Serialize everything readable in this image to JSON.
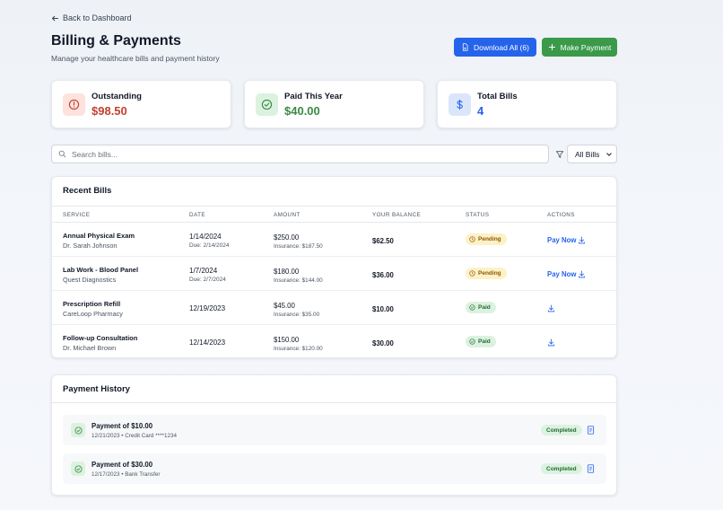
{
  "nav": {
    "back_label": "Back to Dashboard"
  },
  "header": {
    "title": "Billing & Payments",
    "subtitle": "Manage your healthcare bills and payment history",
    "download_label": "Download All (6)",
    "make_payment_label": "Make Payment"
  },
  "stats": [
    {
      "label": "Outstanding",
      "value": "$98.50",
      "icon": "alert-circle-icon",
      "color": "#c2412d",
      "bg": "#fde2de"
    },
    {
      "label": "Paid This Year",
      "value": "$40.00",
      "icon": "check-circle-icon",
      "color": "#3a8a44",
      "bg": "#dcf2e0"
    },
    {
      "label": "Total Bills",
      "value": "4",
      "icon": "dollar-icon",
      "color": "#2563eb",
      "bg": "#dbe6fb"
    }
  ],
  "search": {
    "placeholder": "Search bills..."
  },
  "filter": {
    "selected": "All Bills"
  },
  "bills": {
    "title": "Recent Bills",
    "columns": [
      "SERVICE",
      "DATE",
      "AMOUNT",
      "YOUR BALANCE",
      "STATUS",
      "ACTIONS"
    ],
    "pay_now_label": "Pay Now",
    "rows": [
      {
        "service": "Annual Physical Exam",
        "provider": "Dr. Sarah Johnson",
        "date": "1/14/2024",
        "due": "Due: 2/14/2024",
        "amount": "$250.00",
        "insurance": "Insurance: $187.50",
        "balance": "$62.50",
        "status": "Pending"
      },
      {
        "service": "Lab Work - Blood Panel",
        "provider": "Quest Diagnostics",
        "date": "1/7/2024",
        "due": "Due: 2/7/2024",
        "amount": "$180.00",
        "insurance": "Insurance: $144.00",
        "balance": "$36.00",
        "status": "Pending"
      },
      {
        "service": "Prescription Refill",
        "provider": "CareLoop Pharmacy",
        "date": "12/19/2023",
        "due": "",
        "amount": "$45.00",
        "insurance": "Insurance: $35.00",
        "balance": "$10.00",
        "status": "Paid"
      },
      {
        "service": "Follow-up Consultation",
        "provider": "Dr. Michael Brown",
        "date": "12/14/2023",
        "due": "",
        "amount": "$150.00",
        "insurance": "Insurance: $120.00",
        "balance": "$30.00",
        "status": "Paid"
      }
    ]
  },
  "history": {
    "title": "Payment History",
    "items": [
      {
        "title": "Payment of $10.00",
        "detail": "12/21/2023 • Credit Card ****1234",
        "status": "Completed"
      },
      {
        "title": "Payment of $30.00",
        "detail": "12/17/2023 • Bank Transfer",
        "status": "Completed"
      }
    ]
  }
}
